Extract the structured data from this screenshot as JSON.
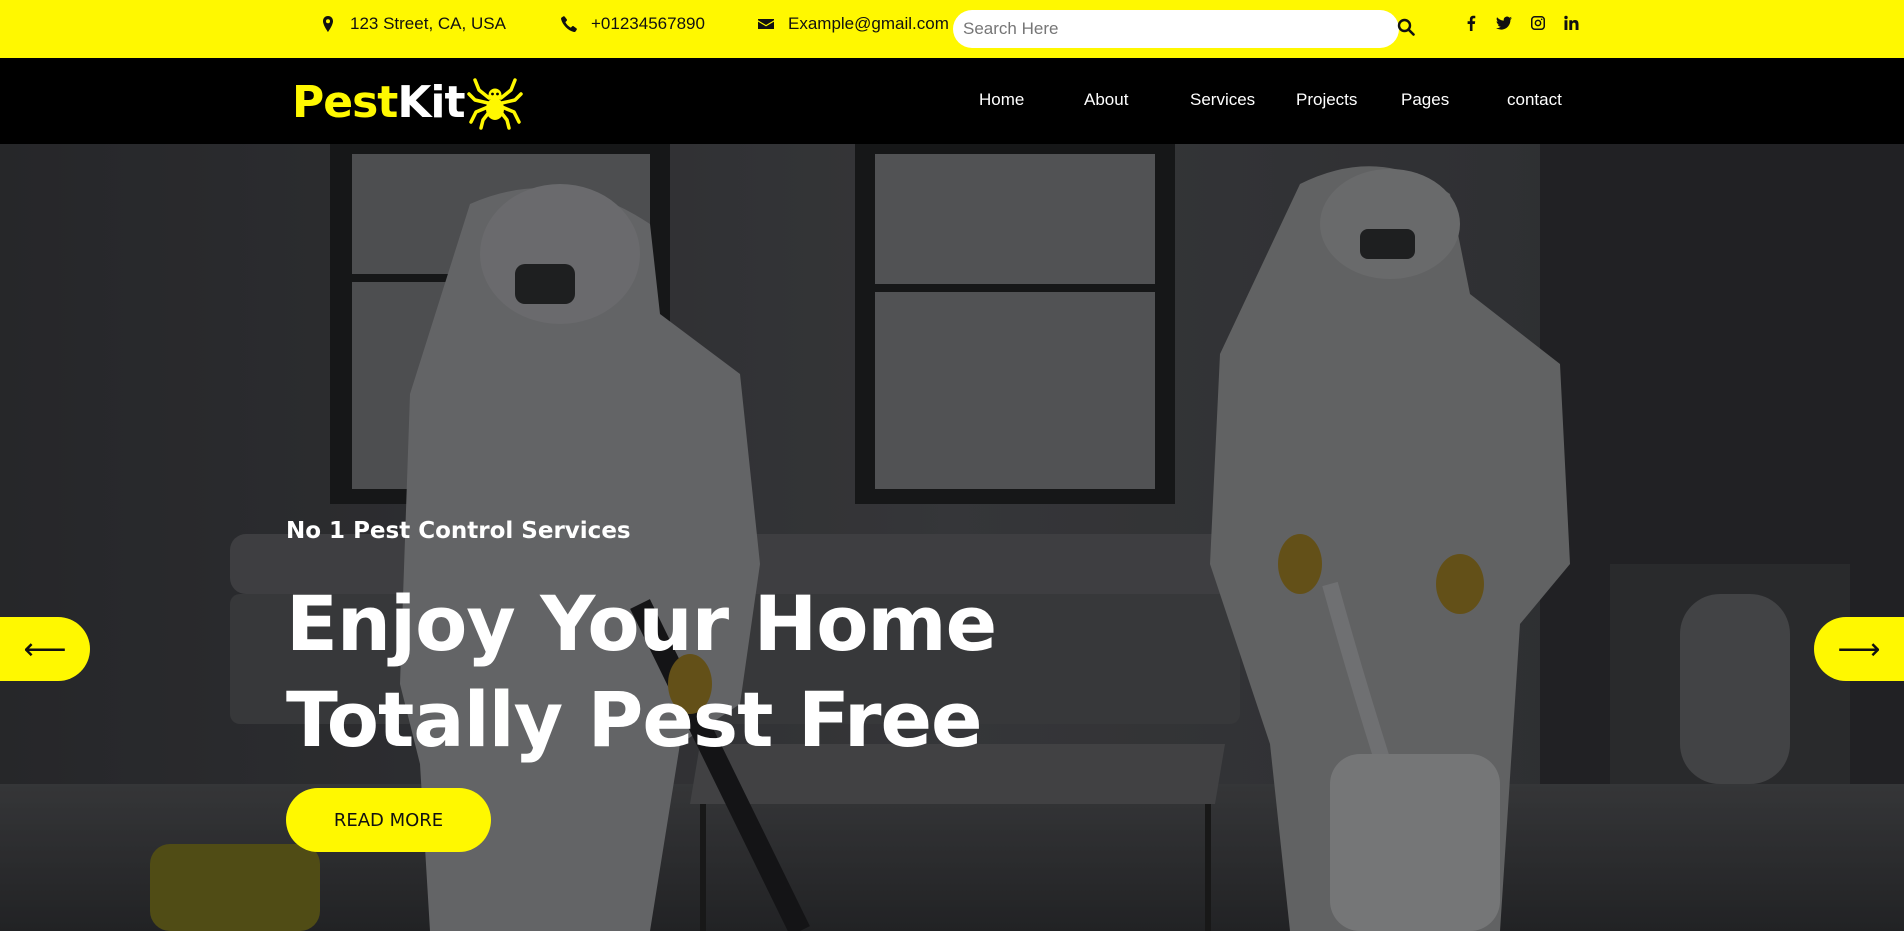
{
  "topbar": {
    "address": "123 Street, CA, USA",
    "phone": "+01234567890",
    "email": "Example@gmail.com",
    "search_placeholder": "Search Here",
    "icons": {
      "address": "map-marker-icon",
      "phone": "phone-icon",
      "email": "envelope-icon",
      "search": "search-icon"
    },
    "social": [
      "facebook-icon",
      "twitter-icon",
      "instagram-icon",
      "linkedin-icon"
    ]
  },
  "logo": {
    "part1": "Pest",
    "part2": "Kit",
    "icon": "spider-icon"
  },
  "nav": {
    "home": "Home",
    "about": "About",
    "services": "Services",
    "projects": "Projects",
    "pages": "Pages",
    "contact": "contact"
  },
  "hero": {
    "subtitle": "No 1 Pest Control Services",
    "title": "Enjoy Your Home Totally Pest Free",
    "cta": "READ MORE",
    "prev_arrow": "⟵",
    "next_arrow": "⟶"
  },
  "colors": {
    "accent": "#fff800",
    "navbar": "#000000",
    "text_light": "#ffffff"
  }
}
